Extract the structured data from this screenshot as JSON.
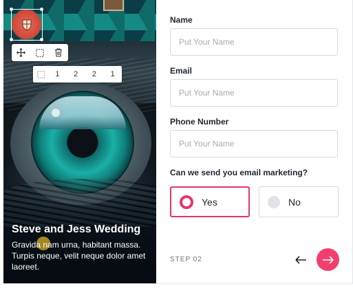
{
  "card": {
    "title": "Steve and Jess Wedding",
    "description": "Gravida nam urna, habitant massa. Turpis neque, velit neque dolor amet laoreet."
  },
  "editor": {
    "toolbar_icons": [
      "move-icon",
      "select-box-icon",
      "trash-icon"
    ],
    "spacing_icon": "spacing-icon",
    "spacing_values": [
      "1",
      "2",
      "2",
      "1"
    ]
  },
  "form": {
    "name": {
      "label": "Name",
      "placeholder": "Put Your Name"
    },
    "email": {
      "label": "Email",
      "placeholder": "Put Your Name"
    },
    "phone": {
      "label": "Phone Number",
      "placeholder": "Put Your Name"
    },
    "marketing": {
      "question": "Can we send you email marketing?",
      "options": [
        {
          "label": "Yes",
          "selected": true
        },
        {
          "label": "No",
          "selected": false
        }
      ]
    },
    "step": "STEP 02"
  },
  "colors": {
    "accent": "#e8336c",
    "next_button": "#f13f6e",
    "border": "#d6d9df"
  }
}
